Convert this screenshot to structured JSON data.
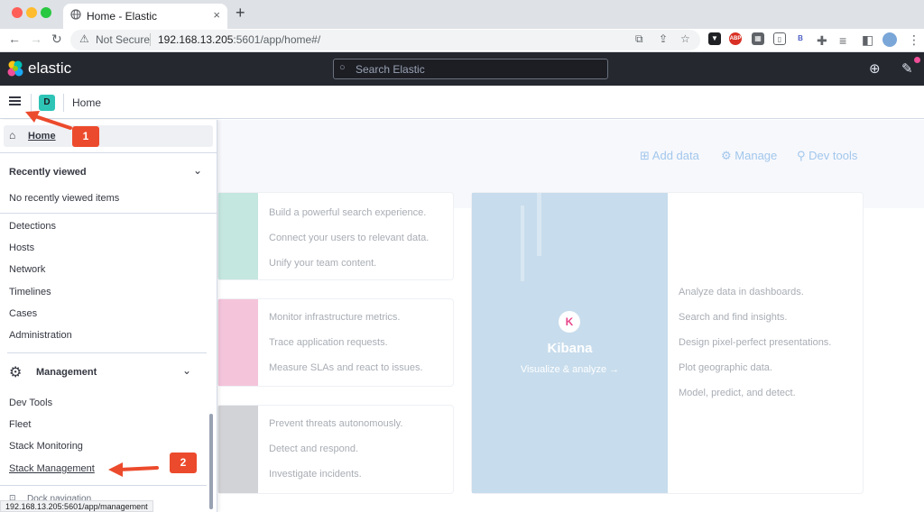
{
  "browser": {
    "tab_title": "Home - Elastic",
    "tab_close": "×",
    "new_tab": "+",
    "not_secure": "Not Secure",
    "url_host": "192.168.13.205",
    "url_path": ":5601/app/home#/",
    "status_url": "192.168.13.205:5601/app/management",
    "ext_abp": "ABP",
    "ext_b": "B"
  },
  "header": {
    "brand": "elastic",
    "search_placeholder": "Search Elastic"
  },
  "breadcrumb": {
    "space_initial": "D",
    "current": "Home"
  },
  "page": {
    "links": [
      "Add data",
      "Manage",
      "Dev tools"
    ],
    "cards": [
      {
        "color": "#c4e7df",
        "lines": [
          "Build a powerful search experience.",
          "Connect your users to relevant data.",
          "Unify your team content."
        ]
      },
      {
        "color": "#f4c4db",
        "lines": [
          "Monitor infrastructure metrics.",
          "Trace application requests.",
          "Measure SLAs and react to issues."
        ]
      },
      {
        "color": "#d2d3d6",
        "lines": [
          "Prevent threats autonomously.",
          "Detect and respond.",
          "Investigate incidents."
        ]
      }
    ],
    "kibana": {
      "title": "Kibana",
      "subtitle": "Visualize & analyze →",
      "lines": [
        "Analyze data in dashboards.",
        "Search and find insights.",
        "Design pixel-perfect presentations.",
        "Plot geographic data.",
        "Model, predict, and detect."
      ]
    }
  },
  "nav": {
    "home": "Home",
    "recently_viewed": "Recently viewed",
    "no_recent": "No recently viewed items",
    "security_items": [
      "Detections",
      "Hosts",
      "Network",
      "Timelines",
      "Cases",
      "Administration"
    ],
    "management": "Management",
    "management_items": [
      "Dev Tools",
      "Fleet",
      "Stack Monitoring",
      "Stack Management"
    ],
    "dock": "Dock navigation"
  },
  "annotations": {
    "step1": "1",
    "step2": "2",
    "color": "#ec4a2c"
  }
}
